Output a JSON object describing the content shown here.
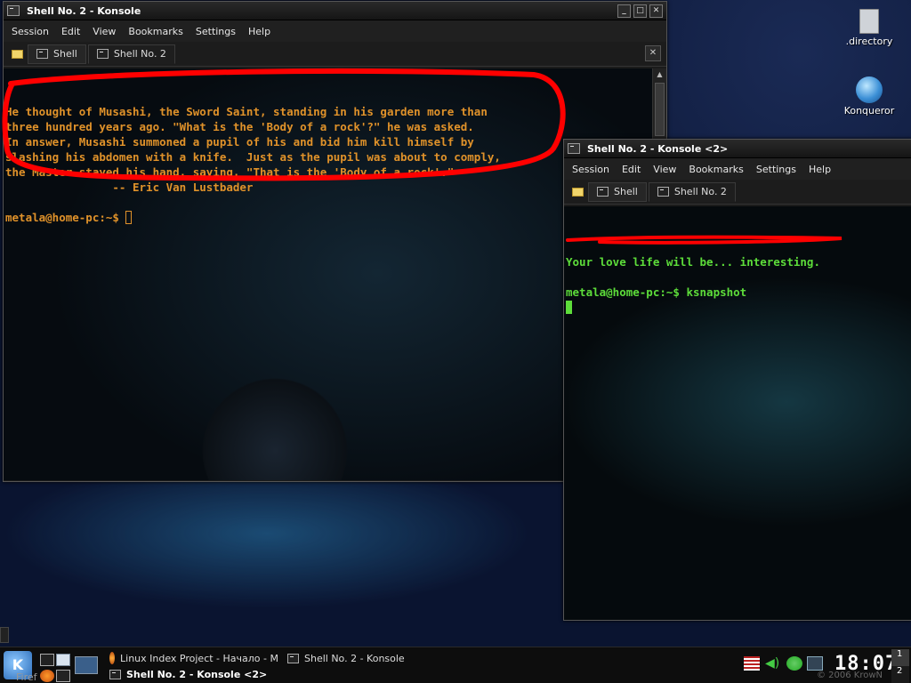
{
  "desktop": {
    "icons": [
      {
        "label": ".directory",
        "icon": "file-icon"
      },
      {
        "label": "Konqueror",
        "icon": "konqueror-icon"
      }
    ]
  },
  "window1": {
    "title": "Shell No. 2 - Konsole",
    "menu": [
      "Session",
      "Edit",
      "View",
      "Bookmarks",
      "Settings",
      "Help"
    ],
    "tabs": [
      "Shell",
      "Shell No. 2"
    ],
    "active_tab": "Shell No. 2",
    "quote_lines": [
      "He thought of Musashi, the Sword Saint, standing in his garden more than",
      "three hundred years ago. \"What is the 'Body of a rock'?\" he was asked.",
      "In answer, Musashi summoned a pupil of his and bid him kill himself by",
      "slashing his abdomen with a knife.  Just as the pupil was about to comply,",
      "the Master stayed his hand, saying, \"That is the 'Body of a rock'.\"",
      "                -- Eric Van Lustbader"
    ],
    "prompt": "metala@home-pc:~$ "
  },
  "window2": {
    "title": "Shell No. 2 - Konsole <2>",
    "menu": [
      "Session",
      "Edit",
      "View",
      "Bookmarks",
      "Settings",
      "Help"
    ],
    "tabs": [
      "Shell",
      "Shell No. 2"
    ],
    "active_tab": "Shell No. 2",
    "fortune": "Your love life will be... interesting.",
    "prompt": "metala@home-pc:~$ ",
    "command": "ksnapshot"
  },
  "taskbar": {
    "tasks": [
      {
        "label": "Linux Index Project - Начало - M",
        "icon": "firefox-icon"
      },
      {
        "label": "Shell No. 2 - Konsole",
        "icon": "terminal-icon"
      },
      {
        "label": "Shell No. 2 - Konsole <2>",
        "icon": "terminal-icon",
        "active": true
      }
    ],
    "clock": "18:07",
    "pager": [
      "1",
      "2"
    ],
    "credit": "© 2006 KrowN",
    "preview_text": "Firef"
  },
  "colors": {
    "quote": "#e0922a",
    "fortune": "#5ddd3a",
    "annotation": "#ff0000"
  }
}
